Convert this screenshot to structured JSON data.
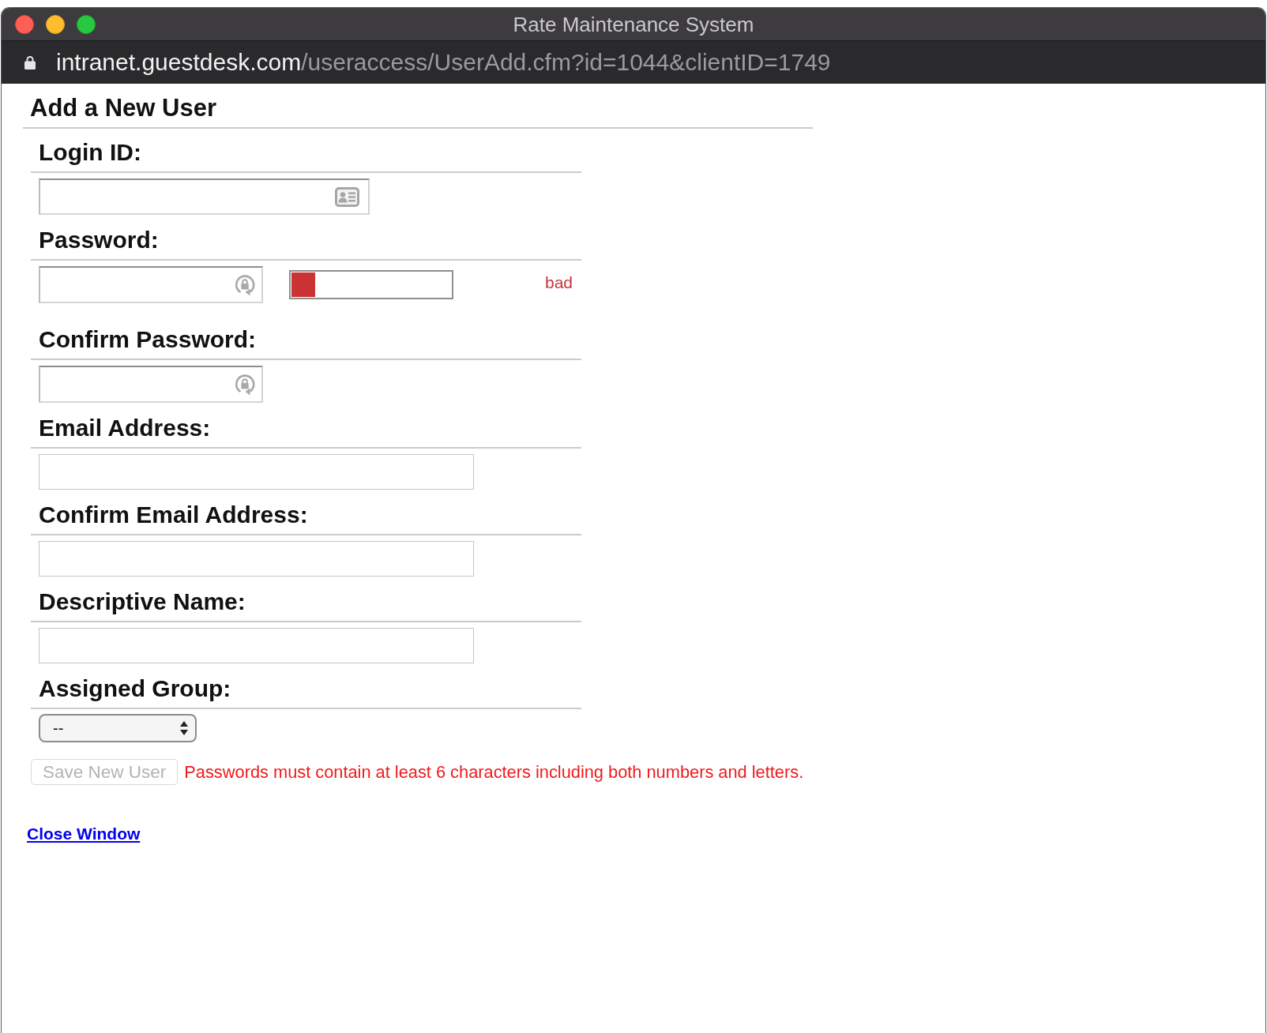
{
  "window": {
    "title": "Rate Maintenance System"
  },
  "address_bar": {
    "host": "intranet.guestdesk.com",
    "path": "/useraccess/UserAdd.cfm?id=1044&clientID=1749"
  },
  "heading": "Add a New User",
  "fields": [
    {
      "kind": "login",
      "label": "Login ID:"
    },
    {
      "kind": "password",
      "label": "Password:",
      "strength": {
        "level": 0.15,
        "reading": "bad"
      }
    },
    {
      "kind": "password",
      "label": "Confirm Password:"
    },
    {
      "kind": "text",
      "label": "Email Address:"
    },
    {
      "kind": "text",
      "label": "Confirm Email Address:"
    },
    {
      "kind": "text",
      "label": "Descriptive Name:"
    },
    {
      "kind": "select",
      "label": "Assigned Group:",
      "value": "--"
    }
  ],
  "save_button": {
    "label": "Save New User",
    "disabled": true
  },
  "message": "Passwords must contain at least 6 characters including both numbers and letters.",
  "close_link": "Close Window"
}
